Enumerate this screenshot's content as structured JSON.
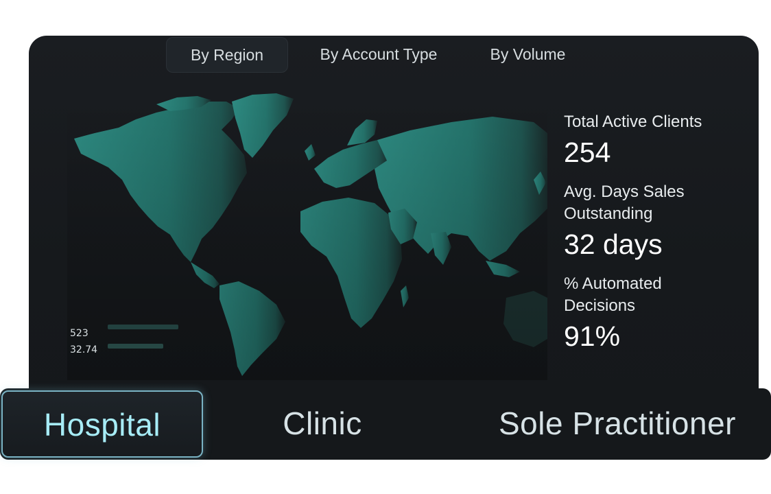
{
  "tabs": [
    {
      "label": "By Region",
      "active": true
    },
    {
      "label": "By Account Type",
      "active": false
    },
    {
      "label": "By Volume",
      "active": false
    }
  ],
  "legend": {
    "value_1": "523",
    "value_2": "32.74"
  },
  "stats": {
    "active_clients_label": "Total Active Clients",
    "active_clients_value": "254",
    "dso_label_line1": "Avg. Days Sales",
    "dso_label_line2": "Outstanding",
    "dso_value": "32 days",
    "automated_label_line1": "% Automated",
    "automated_label_line2": "Decisions",
    "automated_value": "91%"
  },
  "segments": [
    {
      "label": "Hospital",
      "active": true
    },
    {
      "label": "Clinic",
      "active": false
    },
    {
      "label": "Sole Practitioner",
      "active": false
    }
  ],
  "colors": {
    "map_fill": "#2a8a80",
    "accent": "#7ab3c4",
    "panel_background": "#1a1d21"
  }
}
